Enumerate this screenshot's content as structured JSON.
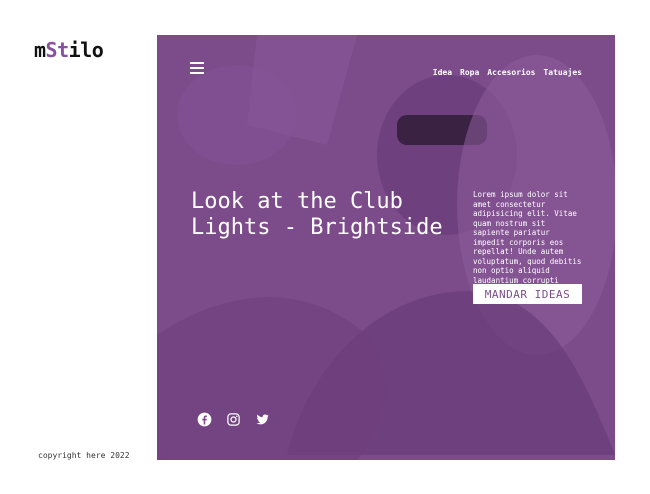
{
  "brand": {
    "logo_part1": "m",
    "logo_accent": "St",
    "logo_part2": "ilo"
  },
  "nav": {
    "items": [
      "Idea",
      "Ropa",
      "Accesorios",
      "Tatuajes"
    ]
  },
  "hero": {
    "title": "Look at the Club Lights - Brightside",
    "description": "Lorem ipsum dolor sit amet consectetur adipisicing elit. Vitae quam nostrum sit sapiente pariatur impedit corporis eos repellat! Unde autem voluptatum, quod debitis non optio aliquid laudantium corrupti eligendi harum?",
    "cta_label": "MANDAR IDEAS",
    "overlay_color": "#7d4d8c"
  },
  "social": [
    "facebook-icon",
    "instagram-icon",
    "twitter-icon"
  ],
  "footer": {
    "copyright": "copyright here 2022"
  }
}
